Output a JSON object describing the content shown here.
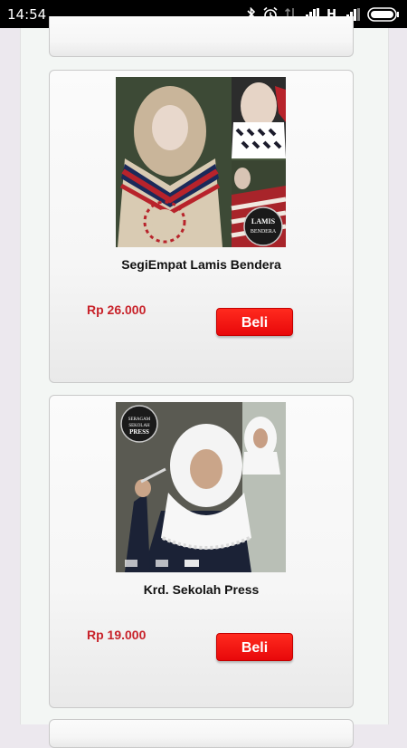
{
  "status_bar": {
    "time": "14:54",
    "network_type": "H",
    "icons": [
      "bluetooth-icon",
      "alarm-icon",
      "data-arrows-icon",
      "signal-icon",
      "signal-icon",
      "battery-icon"
    ]
  },
  "products": [
    {
      "name": "SegiEmpat Lamis Bendera",
      "price": "Rp 26.000",
      "buy_label": "Beli",
      "image_caption": "LAMIS BENDERA"
    },
    {
      "name": "Krd. Sekolah Press",
      "price": "Rp 19.000",
      "buy_label": "Beli",
      "image_caption": "SERAGAM SEKOLAH PRESS"
    }
  ],
  "colors": {
    "price": "#c8222a",
    "buy_button": "#f5100c",
    "card_border": "#c9c9c9"
  }
}
